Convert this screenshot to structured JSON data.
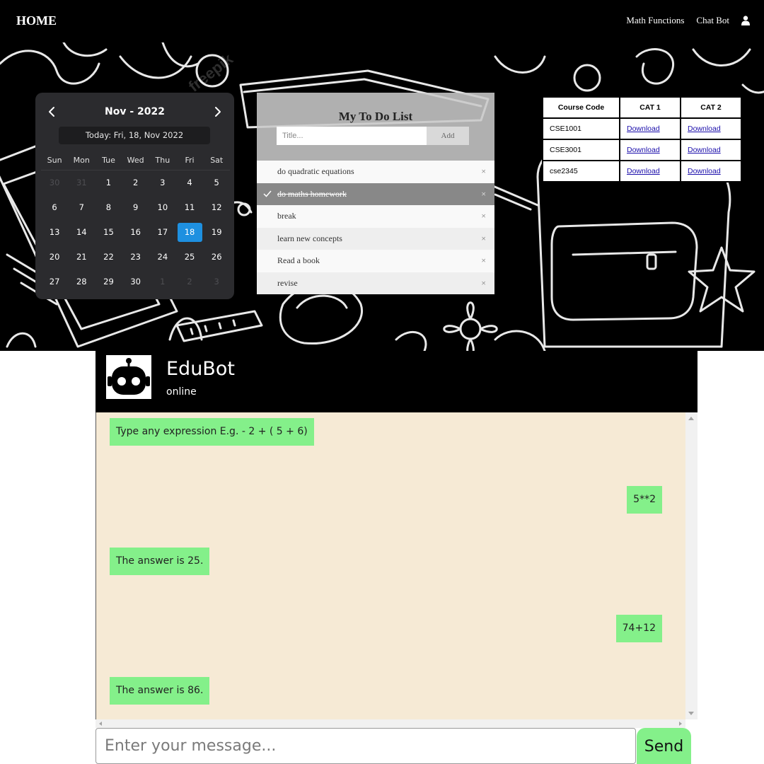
{
  "nav": {
    "brand": "HOME",
    "links": [
      "Math Functions",
      "Chat Bot"
    ],
    "user_icon": "user-icon"
  },
  "calendar": {
    "month_label": "Nov",
    "separator": "-",
    "year_label": "2022",
    "today_label": "Today: Fri, 18, Nov 2022",
    "weekdays": [
      "Sun",
      "Mon",
      "Tue",
      "Wed",
      "Thu",
      "Fri",
      "Sat"
    ],
    "days": [
      {
        "d": "30",
        "muted": true
      },
      {
        "d": "31",
        "muted": true
      },
      {
        "d": "1"
      },
      {
        "d": "2"
      },
      {
        "d": "3"
      },
      {
        "d": "4"
      },
      {
        "d": "5"
      },
      {
        "d": "6"
      },
      {
        "d": "7"
      },
      {
        "d": "8"
      },
      {
        "d": "9"
      },
      {
        "d": "10"
      },
      {
        "d": "11"
      },
      {
        "d": "12"
      },
      {
        "d": "13"
      },
      {
        "d": "14"
      },
      {
        "d": "15"
      },
      {
        "d": "16"
      },
      {
        "d": "17"
      },
      {
        "d": "18",
        "selected": true
      },
      {
        "d": "19"
      },
      {
        "d": "20"
      },
      {
        "d": "21"
      },
      {
        "d": "22"
      },
      {
        "d": "23"
      },
      {
        "d": "24"
      },
      {
        "d": "25"
      },
      {
        "d": "26"
      },
      {
        "d": "27"
      },
      {
        "d": "28"
      },
      {
        "d": "29"
      },
      {
        "d": "30"
      },
      {
        "d": "1",
        "muted": true
      },
      {
        "d": "2",
        "muted": true
      },
      {
        "d": "3",
        "muted": true
      }
    ],
    "selected_color": "#1e90e0"
  },
  "todo": {
    "title": "My To Do List",
    "input_placeholder": "Title...",
    "add_label": "Add",
    "close_glyph": "×",
    "items": [
      {
        "text": "do quadratic equations",
        "checked": false
      },
      {
        "text": "do maths homework",
        "checked": true
      },
      {
        "text": "break",
        "checked": false
      },
      {
        "text": "learn new concepts",
        "checked": false
      },
      {
        "text": "Read a book",
        "checked": false
      },
      {
        "text": "revise",
        "checked": false
      }
    ]
  },
  "courses": {
    "headers": [
      "Course Code",
      "CAT 1",
      "CAT 2"
    ],
    "rows": [
      {
        "code": "CSE1001",
        "cat1": "Download",
        "cat2": "Download"
      },
      {
        "code": "CSE3001",
        "cat1": "Download",
        "cat2": "Download"
      },
      {
        "code": "cse2345",
        "cat1": "Download",
        "cat2": "Download"
      }
    ]
  },
  "chat": {
    "bot_name": "EduBot",
    "status": "online",
    "messages": [
      {
        "from": "bot",
        "text": "Type any expression E.g. - 2 + ( 5 + 6)"
      },
      {
        "from": "user",
        "text": "5**2"
      },
      {
        "from": "bot",
        "text": "The answer is 25."
      },
      {
        "from": "user",
        "text": "74+12"
      },
      {
        "from": "bot",
        "text": "The answer is 86."
      }
    ],
    "input_placeholder": "Enter your message...",
    "send_label": "Send",
    "bubble_color": "#84f08a",
    "background_color": "#f6ead5"
  }
}
